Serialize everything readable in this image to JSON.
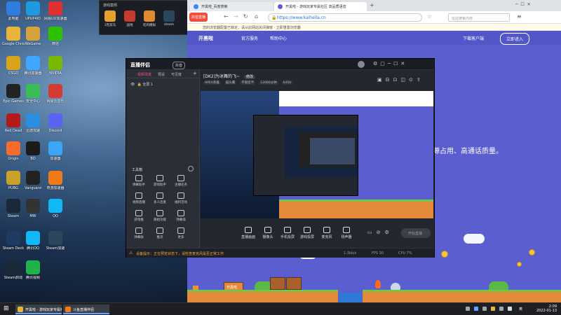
{
  "desktop": {
    "icons": [
      {
        "label": "此电脑",
        "color": "#2f7de1"
      },
      {
        "label": "UPUP4ID",
        "color": "#1e9be0"
      },
      {
        "label": "网易UU加速器",
        "color": "#e0302f"
      },
      {
        "label": "Google Chrome",
        "color": "#e8b53a"
      },
      {
        "label": "WeGame",
        "color": "#d6a23a"
      },
      {
        "label": "微信",
        "color": "#2dc100"
      },
      {
        "label": "CSGO",
        "color": "#d9a31c"
      },
      {
        "label": "腾讯加速器",
        "color": "#3fa7ff"
      },
      {
        "label": "NVIDIA",
        "color": "#76b900"
      },
      {
        "label": "Epic Games",
        "color": "#222222"
      },
      {
        "label": "安全中心",
        "color": "#3bbd55"
      },
      {
        "label": "网易云音乐",
        "color": "#d43c33"
      },
      {
        "label": "Red Dead",
        "color": "#b31b1b"
      },
      {
        "label": "迅游加速",
        "color": "#2a8fe0"
      },
      {
        "label": "Discord",
        "color": "#5865f2"
      },
      {
        "label": "Origin",
        "color": "#f56c2d"
      },
      {
        "label": "BO",
        "color": "#1b1b1b"
      },
      {
        "label": "加速器",
        "color": "#3da5f5"
      },
      {
        "label": "PUBG",
        "color": "#c9a227"
      },
      {
        "label": "Vanguard",
        "color": "#222222"
      },
      {
        "label": "奇游加速器",
        "color": "#f07a1a"
      },
      {
        "label": "Steam",
        "color": "#1b2838"
      },
      {
        "label": "MW",
        "color": "#333333"
      },
      {
        "label": "QQ",
        "color": "#12b7f5"
      },
      {
        "label": "Steam Deck",
        "color": "#1f3b63"
      },
      {
        "label": "腾讯QQ",
        "color": "#12b7f5"
      },
      {
        "label": "Steam加速",
        "color": "#2a475e"
      },
      {
        "label": "Steam启动",
        "color": "#1b2838"
      },
      {
        "label": "腾讯视频",
        "color": "#20b24b"
      }
    ]
  },
  "game_launcher": {
    "header": "游戏案例",
    "items": [
      {
        "label": "3无双马",
        "color": "#e8a02d"
      },
      {
        "label": "战地",
        "color": "#c63b2c"
      },
      {
        "label": "吃鸡模拟",
        "color": "#e08a2c"
      },
      {
        "label": "steam",
        "color": "#2a475e"
      }
    ]
  },
  "browser": {
    "tabs": [
      {
        "label": "开黑啦_百度搜索",
        "color": "#3388ff",
        "active": false
      },
      {
        "label": "开黑啦 - 游戏玩家专属社区 高品质语音",
        "color": "#5b5fd0",
        "active": true
      }
    ],
    "badge": "抖音直播",
    "url": "https://www.kaiheila.cn",
    "search_placeholder": "在此搜索内容",
    "notice": "您的浏览器配置已锁定，请从此网站关闭弹窗 · 立即重置浏览器",
    "site": {
      "brand": "开黑啦",
      "nav": [
        "官方服务",
        "帮助中心"
      ],
      "nav_right": [
        "下载客户端",
        "立即进入"
      ],
      "hero": "源占用、高通话质量。",
      "block_label": "开黑啦"
    }
  },
  "obs": {
    "title": "直播伴侣",
    "badge": "抖音",
    "left_tabs": [
      "视频场景",
      "预设",
      "可见度"
    ],
    "scene": "全屏 1",
    "stream_title": "[DK2]为冰舞的飞~",
    "edit": "修改",
    "tags": [
      "APEX英雄",
      "猫头鹰",
      "不限定不",
      "12000分钟",
      "6450"
    ],
    "tools_header": "工具箱",
    "tools": [
      "弹幕助手",
      "游戏助手",
      "主播任务",
      "视频直播",
      "多人连麦",
      "福利活动",
      "游戏推",
      "跟拍功能",
      "弹幕墙",
      "弹幕收",
      "推流",
      "更多"
    ],
    "controls": [
      "直播画面",
      "摄像头",
      "手机投屏",
      "游戏投屏",
      "麦克风",
      "扬声器"
    ],
    "start": "开始直播",
    "status": "设备提示：正在预览状态下，请检查麦克风是否正常工作",
    "stats": [
      "1.3kb/s",
      "FPS 30",
      "CPU 7%"
    ]
  },
  "taskbar": {
    "items": [
      {
        "label": "开黑啦 - 游戏玩家专属社区...",
        "color": "#e8b53a"
      },
      {
        "label": "斗鱼直播伴侣",
        "color": "#f07a1a"
      }
    ],
    "time": "2:09",
    "date": "2022-01-13",
    "lang": "英"
  }
}
